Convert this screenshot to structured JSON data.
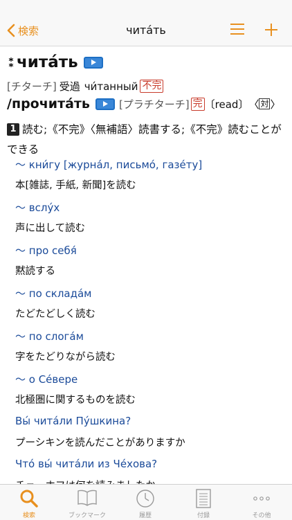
{
  "nav": {
    "back_label": "検索",
    "title": "читáть"
  },
  "entry": {
    "headword": "читáть",
    "line2": {
      "pron": "[チターチ]",
      "pos": "受過",
      "participle": "чи́танный",
      "aspect_tag": "不完"
    },
    "line3": {
      "slash": "/",
      "pair": "прочитáть",
      "pron": "[プラチターチ]",
      "aspect_tag": "完",
      "english": "〔read〕",
      "open_bracket": "〈",
      "tag": "対",
      "close_bracket": "〉"
    },
    "sense_number": "1",
    "sense_text": "読む;《不完》〈無補語〉読書する;《不完》読むことができる",
    "examples": [
      {
        "ru": "〜 кни́гу [журнáл, письмó, газéту]",
        "ja": "本[雑誌, 手紙, 新聞]を読む"
      },
      {
        "ru": "〜 вслýх",
        "ja": "声に出して読む"
      },
      {
        "ru": "〜 про себя́",
        "ja": "黙読する"
      },
      {
        "ru": "〜 по складáм",
        "ja": "たどたどしく読む"
      },
      {
        "ru": "〜 по слогáм",
        "ja": "字をたどりながら読む"
      },
      {
        "ru": "〜 о Сéвере",
        "ja": "北極圏に関するものを読む"
      },
      {
        "ru": "Вы́ читáли Пýшкина?",
        "ja": "プーシキンを読んだことがありますか"
      },
      {
        "ru": "Чтó вы́ читáли из Чéхова?",
        "ja": "チェーホフは何を読みましたか"
      }
    ]
  },
  "tabs": [
    {
      "label": "検索",
      "icon": "search-icon",
      "active": true
    },
    {
      "label": "ブックマーク",
      "icon": "book-icon",
      "active": false
    },
    {
      "label": "履歴",
      "icon": "clock-icon",
      "active": false
    },
    {
      "label": "付録",
      "icon": "document-icon",
      "active": false
    },
    {
      "label": "その他",
      "icon": "more-icon",
      "active": false
    }
  ],
  "colors": {
    "accent": "#e8901f",
    "link_blue": "#1a4a99",
    "tag_red": "#c83a2a"
  }
}
